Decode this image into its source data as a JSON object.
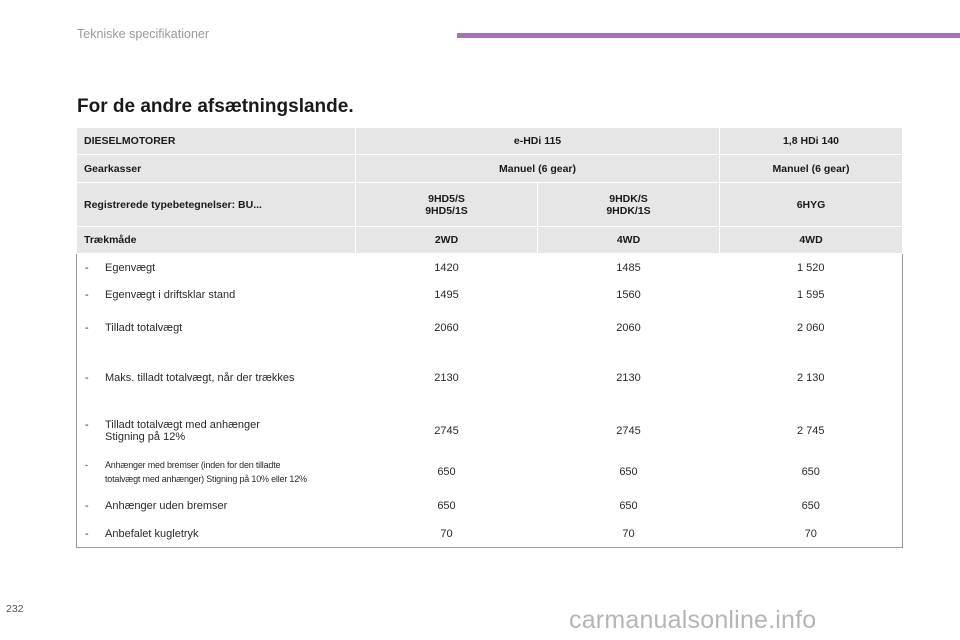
{
  "header": {
    "title": "Tekniske specifikationer",
    "accent_color": "#a573b3"
  },
  "section_title": "For de andre afsætningslande.",
  "table": {
    "head_rows": [
      {
        "label": "DIESELMOTORER",
        "cells": [
          "e-HDi 115",
          "1,8 HDi 140"
        ]
      },
      {
        "label": "Gearkasser",
        "cells": [
          "Manuel (6 gear)",
          "Manuel (6 gear)"
        ]
      },
      {
        "label": "Registrerede typebetegnelser: BU...",
        "cells": [
          [
            "9HD5/S",
            "9HD5/1S"
          ],
          [
            "9HDK/S",
            "9HDK/1S"
          ],
          [
            "6HYG"
          ]
        ]
      },
      {
        "label": "Trækmåde",
        "cells": [
          "2WD",
          "4WD",
          "4WD"
        ]
      }
    ],
    "body_rows": [
      {
        "label": "Egenvægt",
        "values": [
          "1420",
          "1485",
          "1 520"
        ]
      },
      {
        "label": "Egenvægt i driftsklar stand",
        "values": [
          "1495",
          "1560",
          "1 595"
        ]
      },
      {
        "label": "Tilladt totalvægt",
        "values": [
          "2060",
          "2060",
          "2 060"
        ]
      },
      {
        "label": "Maks. tilladt totalvægt, når der trækkes",
        "values": [
          "2130",
          "2130",
          "2 130"
        ]
      },
      {
        "label": [
          "Tilladt totalvægt med anhænger",
          "Stigning på 12%"
        ],
        "values": [
          "2745",
          "2745",
          "2 745"
        ]
      },
      {
        "label": [
          "Anhænger med bremser (inden for den tilladte",
          "totalvægt med anhænger) Stigning på 10% eller 12%"
        ],
        "values": [
          "650",
          "650",
          "650"
        ]
      },
      {
        "label": "Anhænger uden bremser",
        "values": [
          "650",
          "650",
          "650"
        ]
      },
      {
        "label": "Anbefalet kugletryk",
        "values": [
          "70",
          "70",
          "70"
        ]
      }
    ],
    "dash": "-"
  },
  "page_number": "232",
  "watermark": "carmanualsonline.info"
}
